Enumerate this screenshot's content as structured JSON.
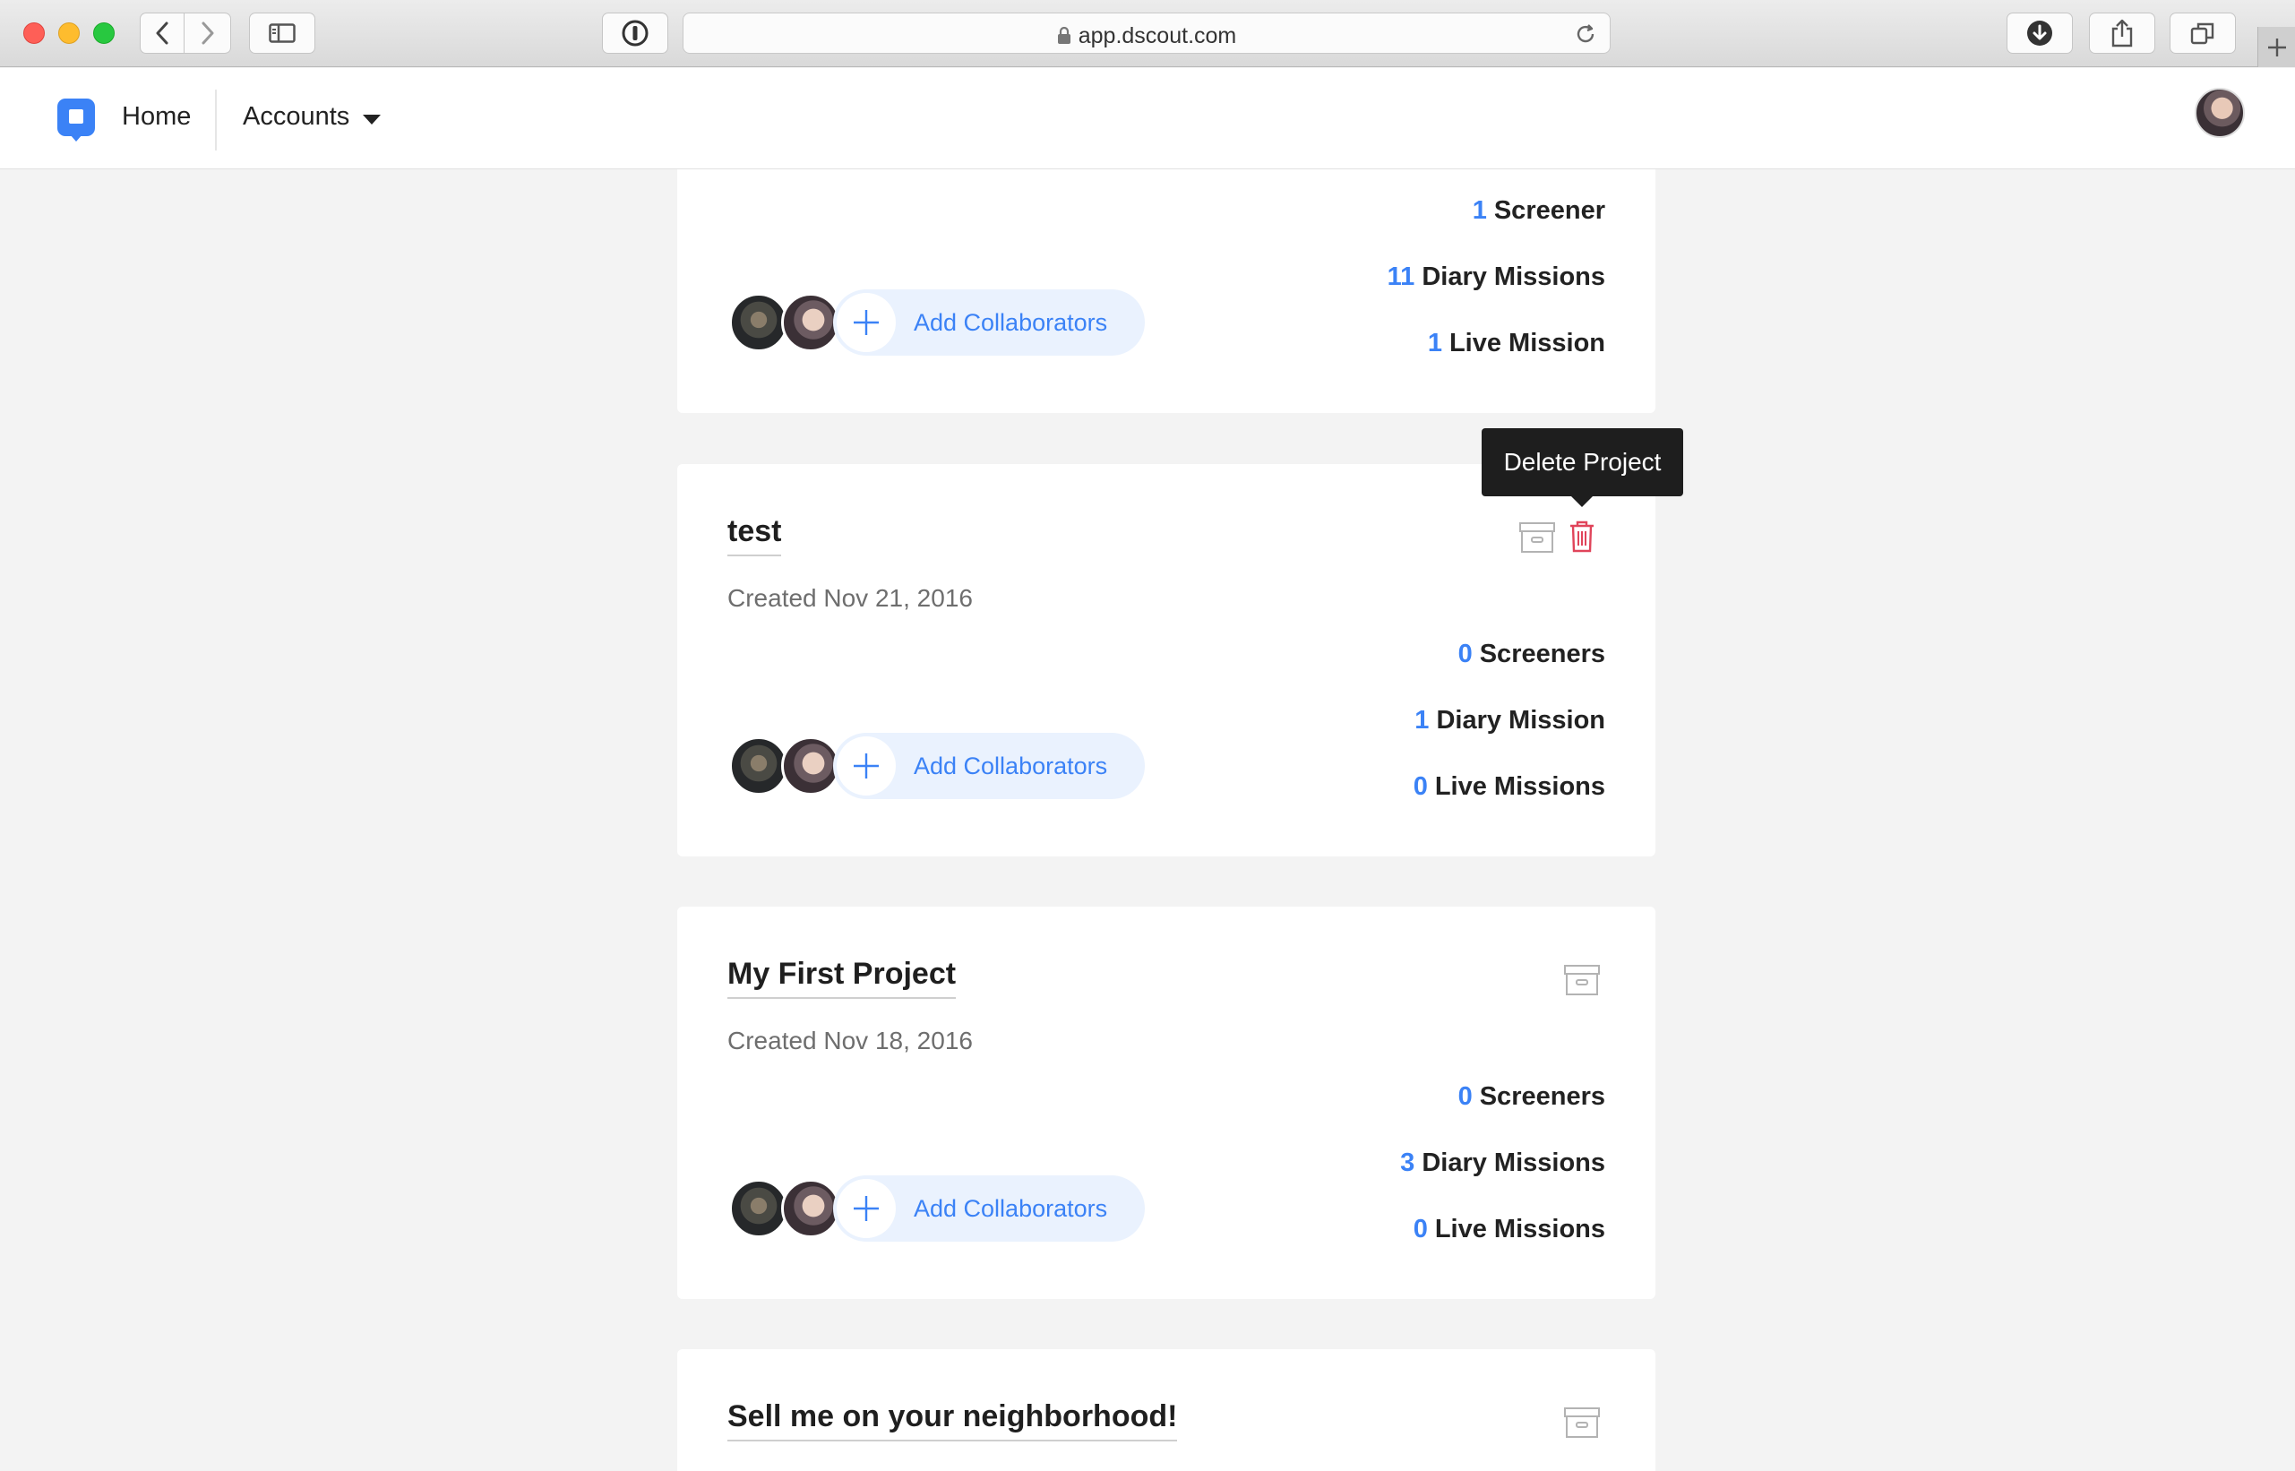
{
  "browser": {
    "url": "app.dscout.com",
    "icons": [
      "back-icon",
      "forward-icon",
      "sidebar-icon",
      "password-icon",
      "lock-icon",
      "reload-icon",
      "download-icon",
      "share-icon",
      "tabs-icon",
      "new-tab-icon"
    ]
  },
  "nav": {
    "home_label": "Home",
    "accounts_label": "Accounts",
    "brand_color": "#3b82f6"
  },
  "card0": {
    "stats": [
      {
        "num": "1",
        "label": "Screener"
      },
      {
        "num": "11",
        "label": "Diary Missions"
      },
      {
        "num": "1",
        "label": "Live Mission"
      }
    ],
    "add_collaborators": "Add Collaborators"
  },
  "card1": {
    "title": "test",
    "created": "Created Nov 21, 2016",
    "stats": [
      {
        "num": "0",
        "label": "Screeners"
      },
      {
        "num": "1",
        "label": "Diary Mission"
      },
      {
        "num": "0",
        "label": "Live Missions"
      }
    ],
    "add_collaborators": "Add Collaborators",
    "tooltip": "Delete Project",
    "delete_color": "#e0445a"
  },
  "card2": {
    "title": "My First Project",
    "created": "Created Nov 18, 2016",
    "stats": [
      {
        "num": "0",
        "label": "Screeners"
      },
      {
        "num": "3",
        "label": "Diary Missions"
      },
      {
        "num": "0",
        "label": "Live Missions"
      }
    ],
    "add_collaborators": "Add Collaborators"
  },
  "card3": {
    "title": "Sell me on your neighborhood!"
  },
  "accent_color": "#3b82f6"
}
